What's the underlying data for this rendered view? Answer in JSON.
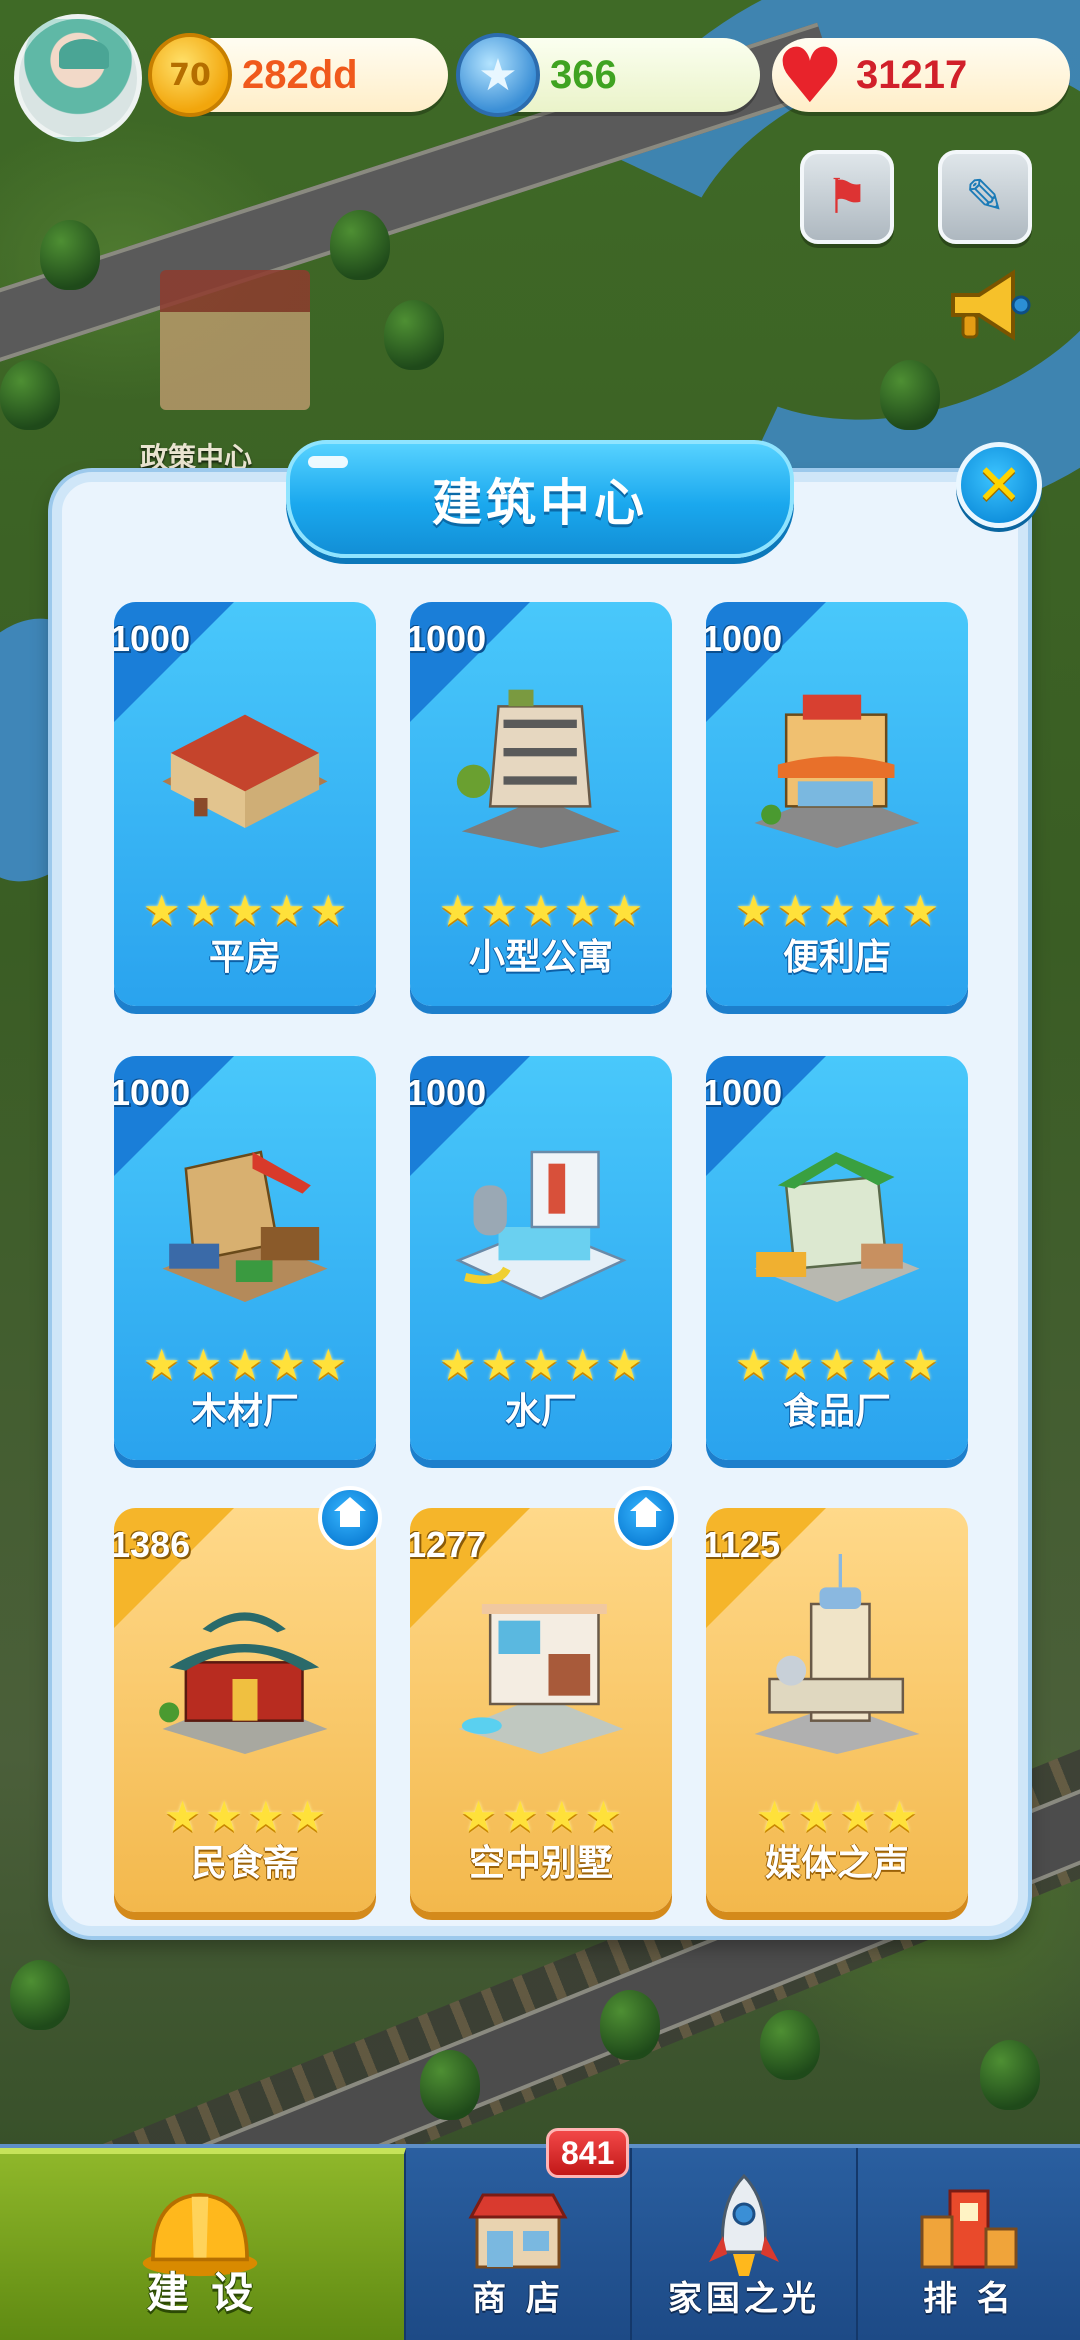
{
  "top_bar": {
    "resources": [
      {
        "type": "coin",
        "icon": "coin-icon",
        "icon_glyph": "70",
        "value": "282dd",
        "color": "#f0591c"
      },
      {
        "type": "star",
        "icon": "blue-star-icon",
        "icon_glyph": "★",
        "value": "366",
        "color": "#3fa321"
      },
      {
        "type": "heart",
        "icon": "heart-icon",
        "icon_glyph": "♥",
        "value": "31217",
        "color": "#d1202a"
      }
    ],
    "side_buttons": [
      {
        "icon": "event-icon",
        "glyph": "⚑"
      },
      {
        "icon": "notepad-icon",
        "glyph": "✎"
      },
      {
        "icon": "megaphone-icon",
        "glyph": "📣"
      }
    ]
  },
  "map": {
    "label": "政策中心"
  },
  "dialog": {
    "title": "建筑中心",
    "close_glyph": "✕",
    "buildings": [
      {
        "price": "1000",
        "name": "平房",
        "stars": 5,
        "tier": "blue",
        "badge": false,
        "art": "bungalow"
      },
      {
        "price": "1000",
        "name": "小型公寓",
        "stars": 5,
        "tier": "blue",
        "badge": false,
        "art": "apartment"
      },
      {
        "price": "1000",
        "name": "便利店",
        "stars": 5,
        "tier": "blue",
        "badge": false,
        "art": "store"
      },
      {
        "price": "1000",
        "name": "木材厂",
        "stars": 5,
        "tier": "blue",
        "badge": false,
        "art": "lumber"
      },
      {
        "price": "1000",
        "name": "水厂",
        "stars": 5,
        "tier": "blue",
        "badge": false,
        "art": "water"
      },
      {
        "price": "1000",
        "name": "食品厂",
        "stars": 5,
        "tier": "blue",
        "badge": false,
        "art": "food"
      },
      {
        "price": "1386",
        "name": "民食斋",
        "stars": 4,
        "tier": "gold",
        "badge": true,
        "art": "restaurant"
      },
      {
        "price": "1277",
        "name": "空中别墅",
        "stars": 4,
        "tier": "gold",
        "badge": true,
        "art": "villa"
      },
      {
        "price": "1125",
        "name": "媒体之声",
        "stars": 4,
        "tier": "gold",
        "badge": false,
        "art": "media"
      }
    ]
  },
  "bottom_nav": {
    "items": [
      {
        "label": "建 设",
        "icon": "hard-hat-icon",
        "active": true
      },
      {
        "label": "商 店",
        "icon": "shop-icon",
        "active": false
      },
      {
        "label": "家国之光",
        "icon": "rocket-icon",
        "active": false
      },
      {
        "label": "排 名",
        "icon": "ranking-icon",
        "active": false
      }
    ],
    "shop_badge": "841"
  },
  "colors": {
    "card_blue": "#2aa3ee",
    "card_gold": "#f3b84c",
    "nav_active": "#7aa320",
    "nav_bg": "#2a5fa0"
  }
}
